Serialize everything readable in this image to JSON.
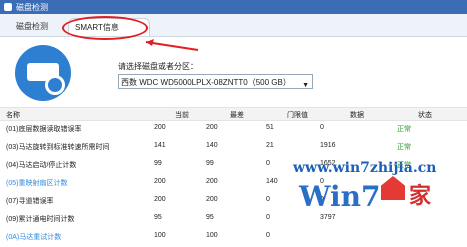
{
  "window": {
    "title": "磁盘检测"
  },
  "tabs": [
    {
      "label": "磁盘检测",
      "active": false
    },
    {
      "label": "SMART信息",
      "active": true
    }
  ],
  "selector": {
    "label": "请选择磁盘或者分区：",
    "selected": "西数 WDC WD5000LPLX-08ZNTT0（500 GB）"
  },
  "table": {
    "columns": [
      "名称",
      "当前",
      "最差",
      "门限值",
      "数据",
      "状态"
    ],
    "rows": [
      {
        "name": "(01)底层数据读取错误率",
        "current": "200",
        "worst": "200",
        "threshold": "51",
        "data": "0",
        "status": "正常"
      },
      {
        "name": "(03)马达旋转到标准转速所需时间",
        "current": "141",
        "worst": "140",
        "threshold": "21",
        "data": "1916",
        "status": "正常"
      },
      {
        "name": "(04)马达启动/停止计数",
        "current": "99",
        "worst": "99",
        "threshold": "0",
        "data": "1652",
        "status": "正常"
      },
      {
        "name": "(05)重映射扇区计数",
        "current": "200",
        "worst": "200",
        "threshold": "140",
        "data": "0",
        "status": ""
      },
      {
        "name": "(07)寻道错误率",
        "current": "200",
        "worst": "200",
        "threshold": "0",
        "data": "0",
        "status": ""
      },
      {
        "name": "(09)累计通电时间计数",
        "current": "95",
        "worst": "95",
        "threshold": "0",
        "data": "3797",
        "status": ""
      },
      {
        "name": "(0A)马达重试计数",
        "current": "100",
        "worst": "100",
        "threshold": "0",
        "data": "",
        "status": ""
      }
    ]
  },
  "watermark": {
    "url": "www.win7zhijia.cn",
    "logo": "Win7",
    "home": "家"
  },
  "colors": {
    "titlebar": "#3a6db5",
    "accent": "#2e7fd1",
    "status_ok": "#2b9b2b",
    "annotation": "#e21e23"
  },
  "icons": {
    "disk": "disk-search-icon",
    "caret": "chevron-down-icon"
  }
}
